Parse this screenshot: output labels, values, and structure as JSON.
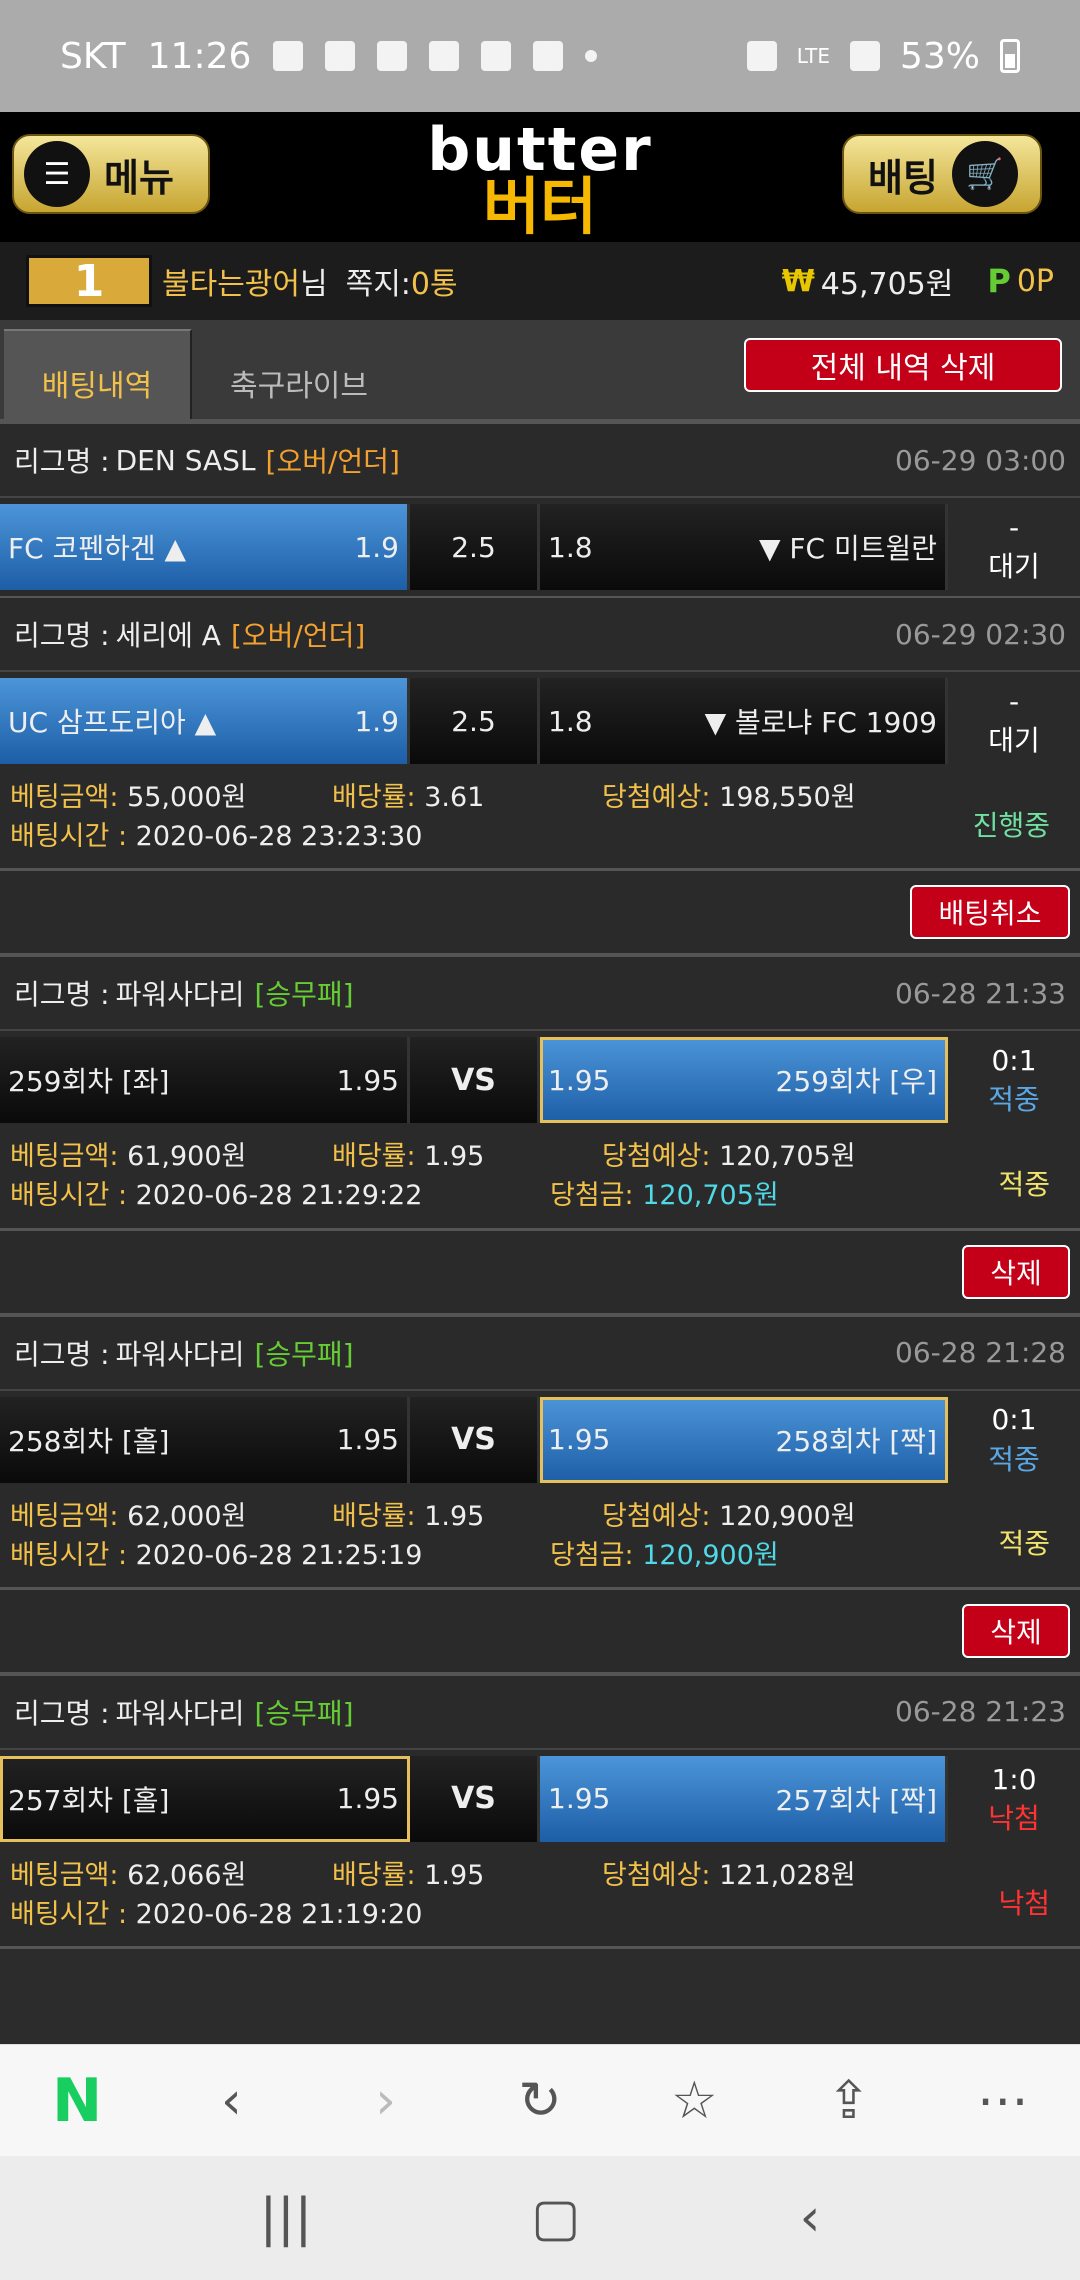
{
  "statusbar": {
    "carrier": "SKT",
    "time": "11:26",
    "network": "LTE",
    "battery": "53%"
  },
  "header": {
    "menu_label": "메뉴",
    "logo_en": "butter",
    "logo_ko": "버터",
    "bet_label": "배팅"
  },
  "user": {
    "level": "1",
    "name": "불타는광어",
    "suffix": "님",
    "msg_label": "쪽지:",
    "msg_value": "0통",
    "currency_symbol": "₩",
    "balance": "45,705원",
    "points_symbol": "P",
    "points": "0P"
  },
  "tabs": {
    "betting_history": "배팅내역",
    "soccer_live": "축구라이브",
    "delete_all": "전체 내역 삭제"
  },
  "labels": {
    "league": "리그명 :",
    "amount": "베팅금액:",
    "rate": "배당률:",
    "expected": "당첨예상:",
    "time": "배팅시간 :",
    "win_amount": "당첨금:",
    "cancel": "배팅취소",
    "delete": "삭제",
    "vs": "VS"
  },
  "bets": [
    {
      "games": [
        {
          "league": "DEN SASL",
          "type": "[오버/언더]",
          "date": "06-29 03:00",
          "home": "FC 코펜하겐 ▲",
          "home_odds": "1.9",
          "mid": "2.5",
          "away_odds": "1.8",
          "away": "▼ FC 미트윌란",
          "result_top": "-",
          "result": "대기"
        },
        {
          "league": "세리에 A",
          "type": "[오버/언더]",
          "date": "06-29 02:30",
          "home": "UC 삼프도리아 ▲",
          "home_odds": "1.9",
          "mid": "2.5",
          "away_odds": "1.8",
          "away": "▼ 볼로냐 FC 1909",
          "result_top": "-",
          "result": "대기"
        }
      ],
      "amount": "55,000원",
      "rate": "3.61",
      "expected": "198,550원",
      "time": "2020-06-28 23:23:30",
      "status": "진행중"
    },
    {
      "games": [
        {
          "league": "파워사다리",
          "type": "[승무패]",
          "date": "06-28 21:33",
          "home": "259회차 [좌]",
          "home_odds": "1.95",
          "away_odds": "1.95",
          "away": "259회차 [우]",
          "result_top": "0:1",
          "result": "적중"
        }
      ],
      "amount": "61,900원",
      "rate": "1.95",
      "expected": "120,705원",
      "time": "2020-06-28 21:29:22",
      "win_amount": "120,705원",
      "status": "적중"
    },
    {
      "games": [
        {
          "league": "파워사다리",
          "type": "[승무패]",
          "date": "06-28 21:28",
          "home": "258회차 [홀]",
          "home_odds": "1.95",
          "away_odds": "1.95",
          "away": "258회차 [짝]",
          "result_top": "0:1",
          "result": "적중"
        }
      ],
      "amount": "62,000원",
      "rate": "1.95",
      "expected": "120,900원",
      "time": "2020-06-28 21:25:19",
      "win_amount": "120,900원",
      "status": "적중"
    },
    {
      "games": [
        {
          "league": "파워사다리",
          "type": "[승무패]",
          "date": "06-28 21:23",
          "home": "257회차 [홀]",
          "home_odds": "1.95",
          "away_odds": "1.95",
          "away": "257회차 [짝]",
          "result_top": "1:0",
          "result": "낙첨"
        }
      ],
      "amount": "62,066원",
      "rate": "1.95",
      "expected": "121,028원",
      "time": "2020-06-28 21:19:20",
      "status": "낙첨"
    }
  ],
  "browser": {
    "naver": "N"
  }
}
